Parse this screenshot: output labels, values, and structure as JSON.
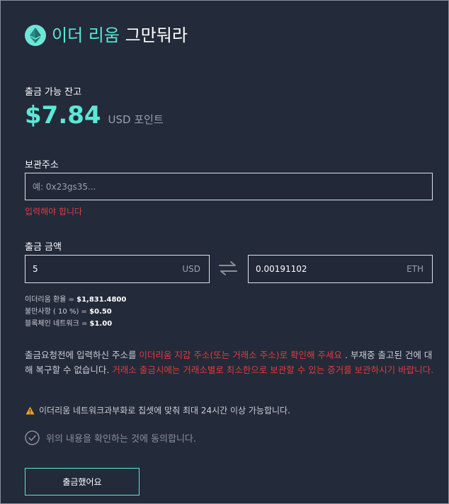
{
  "header": {
    "title_accent": "이더 리움",
    "title_rest": " 그만둬라",
    "icon": "ethereum-icon"
  },
  "balance": {
    "label": "출금 가능 잔고",
    "amount": "$7.84",
    "unit": "USD 포인트"
  },
  "address": {
    "label": "보관주소",
    "placeholder": "예: 0x23gs35...",
    "error": "입력해야 합니다"
  },
  "withdraw": {
    "label": "출금 금액",
    "usd_value": "5",
    "usd_unit": "USD",
    "eth_value": "0.00191102",
    "eth_unit": "ETH",
    "swap_icon": "swap-arrows-icon"
  },
  "rates": {
    "exchange_label": "이더리움 환율 = ",
    "exchange_value": "$1,831.4800",
    "fee_label": "불만사항 ( 10 %) = ",
    "fee_value": "$0.50",
    "network_label": "블록체인 네트워크 = ",
    "network_value": "$1.00"
  },
  "notice": {
    "part1": "출금요청전에 입력하신 주소를 ",
    "part2_red": "이더리움 지갑 주소(또는 거래소 주소)로 확인해 주세요",
    "part3": " . 부재중 출고된 건에 대해 복구할 수 없습니다. ",
    "part4_red": "거래소 출금시에는 거래소별로 최소한으로 보관할 수 있는 증거를 보관하시기 바랍니다."
  },
  "warning": {
    "icon": "warning-icon",
    "text": "이더리움 네트워크과부화로 칩셋에 맞춰 최대 24시간 이상 가능합니다."
  },
  "agree": {
    "icon": "check-circle-icon",
    "text": "위의 내용을 확인하는 것에 동의합니다."
  },
  "submit": {
    "label": "출금했어요"
  },
  "colors": {
    "background": "#232a3a",
    "accent": "#5de8d6",
    "error": "#e23b3b",
    "muted": "#9aa0ab"
  }
}
